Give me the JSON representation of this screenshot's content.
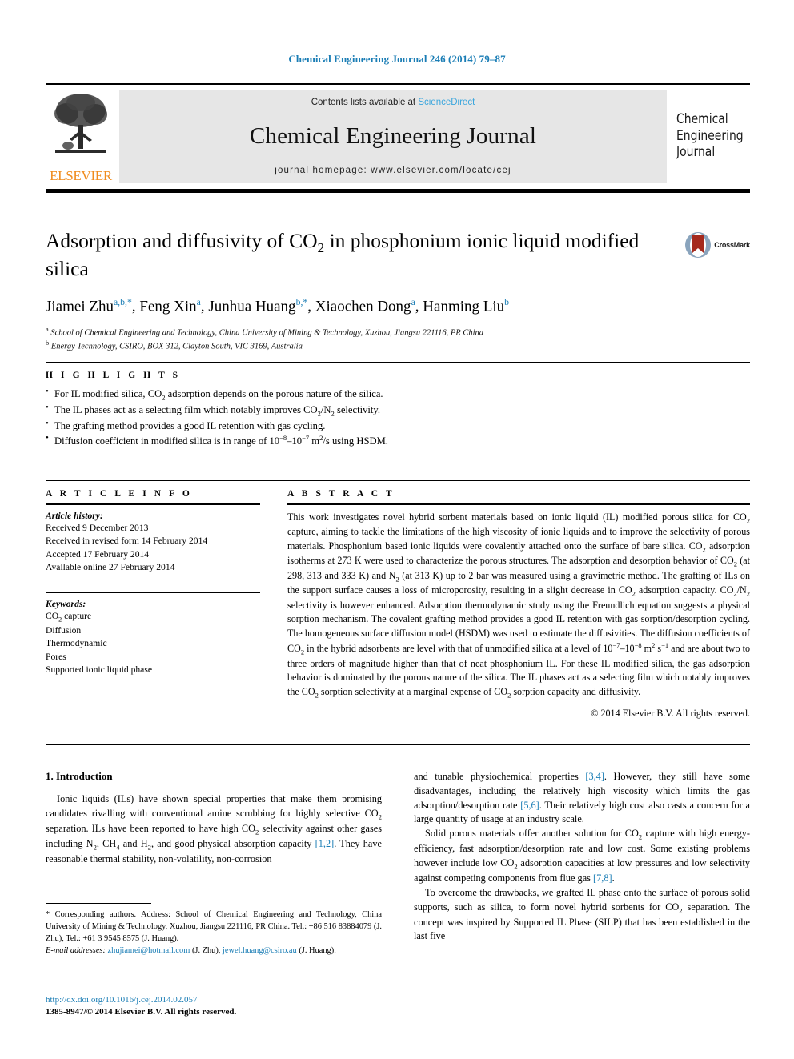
{
  "running_head": "Chemical Engineering Journal 246 (2014) 79–87",
  "masthead": {
    "contents_prefix": "Contents lists available at",
    "sciencedirect": "ScienceDirect",
    "journal_title": "Chemical Engineering Journal",
    "homepage": "journal homepage: www.elsevier.com/locate/cej",
    "publisher_wordmark": "ELSEVIER",
    "cover_lines": [
      "Chemical",
      "Engineering",
      "Journal"
    ],
    "colors": {
      "link": "#3ba6dd",
      "elsevier_orange": "#f08c1e",
      "band": "#e6e6e6"
    }
  },
  "article": {
    "title_part1": "Adsorption and diffusivity of CO",
    "title_sub": "2",
    "title_part2": " in phosphonium ionic liquid modified silica",
    "crossmark_label": "CrossMark",
    "authors_html": "Jiamei Zhu a,b,*, Feng Xin a, Junhua Huang b,*, Xiaochen Dong a, Hanming Liu b",
    "affiliations": [
      {
        "marker": "a",
        "text": "School of Chemical Engineering and Technology, China University of Mining & Technology, Xuzhou, Jiangsu 221116, PR China"
      },
      {
        "marker": "b",
        "text": "Energy Technology, CSIRO, BOX 312, Clayton South, VIC 3169, Australia"
      }
    ]
  },
  "highlights": {
    "label": "H I G H L I G H T S",
    "items": [
      "For IL modified silica, CO2 adsorption depends on the porous nature of the silica.",
      "The IL phases act as a selecting film which notably improves CO2/N2 selectivity.",
      "The grafting method provides a good IL retention with gas cycling.",
      "Diffusion coefficient in modified silica is in range of 10−8–10−7 m2/s using HSDM."
    ]
  },
  "article_info": {
    "label": "A R T I C L E   I N F O",
    "history_title": "Article history:",
    "history": [
      "Received 9 December 2013",
      "Received in revised form 14 February 2014",
      "Accepted 17 February 2014",
      "Available online 27 February 2014"
    ],
    "keywords_title": "Keywords:",
    "keywords": [
      "CO2 capture",
      "Diffusion",
      "Thermodynamic",
      "Pores",
      "Supported ionic liquid phase"
    ]
  },
  "abstract": {
    "label": "A B S T R A C T",
    "text": "This work investigates novel hybrid sorbent materials based on ionic liquid (IL) modified porous silica for CO2 capture, aiming to tackle the limitations of the high viscosity of ionic liquids and to improve the selectivity of porous materials. Phosphonium based ionic liquids were covalently attached onto the surface of bare silica. CO2 adsorption isotherms at 273 K were used to characterize the porous structures. The adsorption and desorption behavior of CO2 (at 298, 313 and 333 K) and N2 (at 313 K) up to 2 bar was measured using a gravimetric method. The grafting of ILs on the support surface causes a loss of microporosity, resulting in a slight decrease in CO2 adsorption capacity. CO2/N2 selectivity is however enhanced. Adsorption thermodynamic study using the Freundlich equation suggests a physical sorption mechanism. The covalent grafting method provides a good IL retention with gas sorption/desorption cycling. The homogeneous surface diffusion model (HSDM) was used to estimate the diffusivities. The diffusion coefficients of CO2 in the hybrid adsorbents are level with that of unmodified silica at a level of 10−7–10−8 m2 s−1 and are about two to three orders of magnitude higher than that of neat phosphonium IL. For these IL modified silica, the gas adsorption behavior is dominated by the porous nature of the silica. The IL phases act as a selecting film which notably improves the CO2 sorption selectivity at a marginal expense of CO2 sorption capacity and diffusivity.",
    "copyright": "© 2014 Elsevier B.V. All rights reserved."
  },
  "introduction": {
    "heading": "1. Introduction",
    "left_paragraph": "Ionic liquids (ILs) have shown special properties that make them promising candidates rivalling with conventional amine scrubbing for highly selective CO2 separation. ILs have been reported to have high CO2 selectivity against other gases including N2, CH4 and H2, and good physical absorption capacity [1,2]. They have reasonable thermal stability, non-volatility, non-corrosion",
    "right_paragraph_1": "and tunable physiochemical properties [3,4]. However, they still have some disadvantages, including the relatively high viscosity which limits the gas adsorption/desorption rate [5,6]. Their relatively high cost also casts a concern for a large quantity of usage at an industry scale.",
    "right_paragraph_2": "Solid porous materials offer another solution for CO2 capture with high energy-efficiency, fast adsorption/desorption rate and low cost. Some existing problems however include low CO2 adsorption capacities at low pressures and low selectivity against competing components from flue gas [7,8].",
    "right_paragraph_3": "To overcome the drawbacks, we grafted IL phase onto the surface of porous solid supports, such as silica, to form novel hybrid sorbents for CO2 separation. The concept was inspired by Supported IL Phase (SILP) that has been established in the last five"
  },
  "footnote": {
    "corresponding": "* Corresponding authors. Address: School of Chemical Engineering and Technology, China University of Mining & Technology, Xuzhou, Jiangsu 221116, PR China. Tel.: +86 516 83884079 (J. Zhu), Tel.: +61 3 9545 8575 (J. Huang).",
    "email_label": "E-mail addresses:",
    "email1": "zhujiamei@hotmail.com",
    "email1_owner": "(J. Zhu),",
    "email2": "jewel.huang@csiro.au",
    "email2_owner": "(J. Huang)."
  },
  "doi": {
    "url": "http://dx.doi.org/10.1016/j.cej.2014.02.057",
    "issn_line": "1385-8947/© 2014 Elsevier B.V. All rights reserved."
  }
}
